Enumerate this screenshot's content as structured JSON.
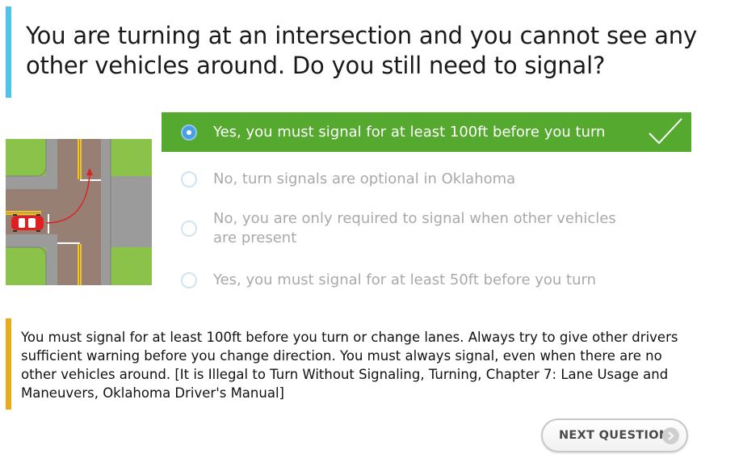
{
  "question": {
    "text": "You are turning at an intersection and you cannot see any other vehicles around. Do you still need to signal?"
  },
  "answers": [
    {
      "label": "Yes, you must signal for at least 100ft before you turn",
      "selected": true,
      "correct": true
    },
    {
      "label": "No, turn signals are optional in Oklahoma",
      "selected": false,
      "correct": false
    },
    {
      "label": "No, you are only required to signal when other vehicles are present",
      "selected": false,
      "correct": false
    },
    {
      "label": "Yes, you must signal for at least 50ft before you turn",
      "selected": false,
      "correct": false
    }
  ],
  "explanation": {
    "text": "You must signal for at least 100ft before you turn or change lanes. Always try to give other drivers sufficient warning before you change direction. You must always signal, even when there are no other vehicles around. [It is Illegal to Turn Without Signaling, Turning, Chapter 7: Lane Usage and Maneuvers, Oklahoma Driver's Manual]"
  },
  "next_button": {
    "label": "NEXT QUESTION",
    "icon": "chevron-right-icon"
  },
  "illustration": {
    "subject": "car-turning-at-t-intersection"
  },
  "colors": {
    "question_accent": "#4fc3e8",
    "correct_answer": "#54a92e",
    "explanation_accent": "#e8ab1c",
    "radio_selected": "#4a9fe0",
    "car": "#e02020",
    "grass": "#8bc34a",
    "road": "#9a8478"
  }
}
